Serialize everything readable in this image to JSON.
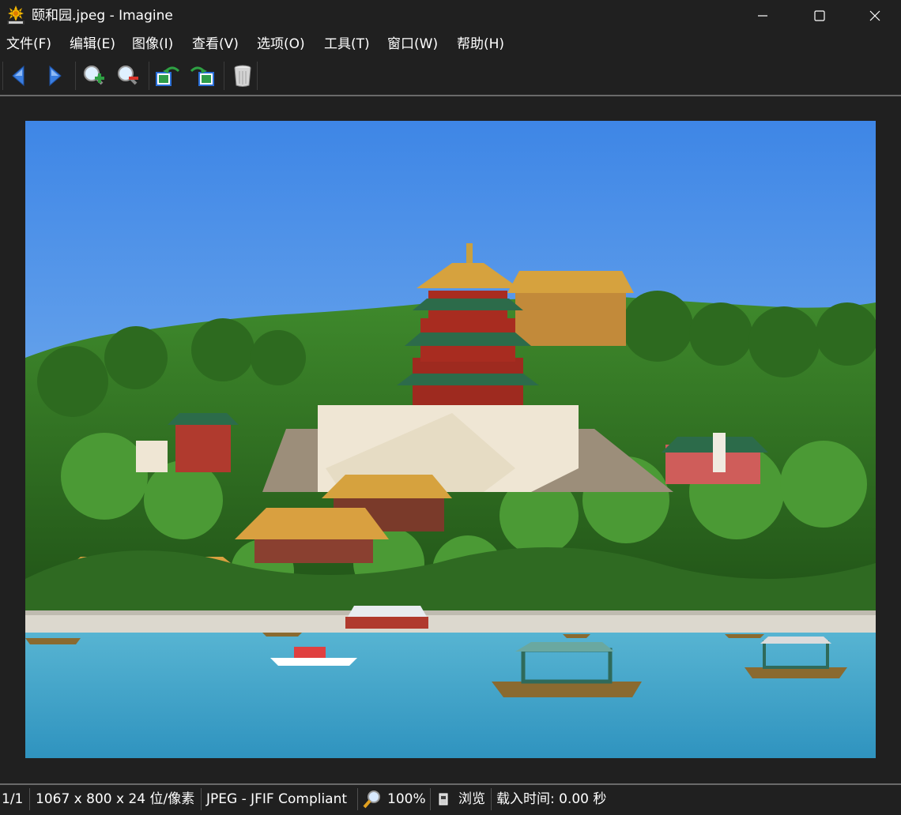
{
  "window": {
    "title": "颐和园.jpeg - Imagine",
    "controls": [
      "minimize",
      "maximize",
      "close"
    ]
  },
  "menu": [
    {
      "label": "文件(F)"
    },
    {
      "label": "编辑(E)"
    },
    {
      "label": "图像(I)"
    },
    {
      "label": "查看(V)"
    },
    {
      "label": "选项(O)"
    },
    {
      "label": "工具(T)"
    },
    {
      "label": "窗口(W)"
    },
    {
      "label": "帮助(H)"
    }
  ],
  "toolbar": {
    "buttons": [
      "previous-arrow-icon",
      "next-arrow-icon",
      "zoom-in-icon",
      "zoom-out-icon",
      "rotate-left-icon",
      "rotate-right-icon",
      "delete-icon"
    ]
  },
  "image": {
    "description_scene": "Summer Palace tower on green hill with lake and boats",
    "colors": {
      "sky": "#4a90e2",
      "water": "#3fa6c8",
      "foliage": "#2f6e24",
      "roof": "#c89a3a"
    }
  },
  "status": {
    "index": "1/1",
    "dimensions": "1067 x 800 x 24 位/像素",
    "format": "JPEG - JFIF Compliant",
    "zoom": "100%",
    "mode": "浏览",
    "load_time": "载入时间: 0.00 秒"
  },
  "colors": {
    "background": "#202020",
    "text": "#ffffff",
    "separator": "#6a6a6a",
    "accent_blue": "#2a6fd8"
  }
}
